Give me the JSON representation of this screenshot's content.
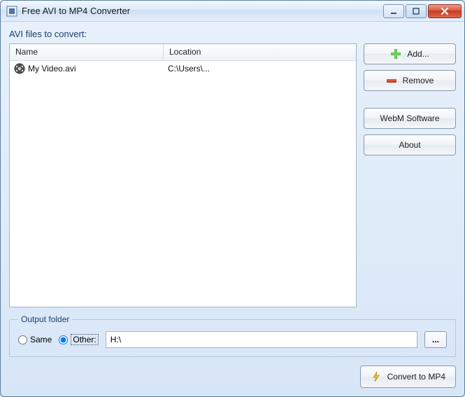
{
  "window": {
    "title": "Free AVI to MP4 Converter"
  },
  "labels": {
    "files_section": "AVI files to convert:",
    "col_name": "Name",
    "col_location": "Location",
    "output_legend": "Output folder",
    "radio_same": "Same",
    "radio_other": "Other:",
    "browse": "..."
  },
  "buttons": {
    "add": "Add...",
    "remove": "Remove",
    "webm": "WebM Software",
    "about": "About",
    "convert": "Convert to MP4"
  },
  "files": [
    {
      "name": "My Video.avi",
      "location": "C:\\Users\\..."
    }
  ],
  "output": {
    "selected": "other",
    "path": "H:\\"
  }
}
